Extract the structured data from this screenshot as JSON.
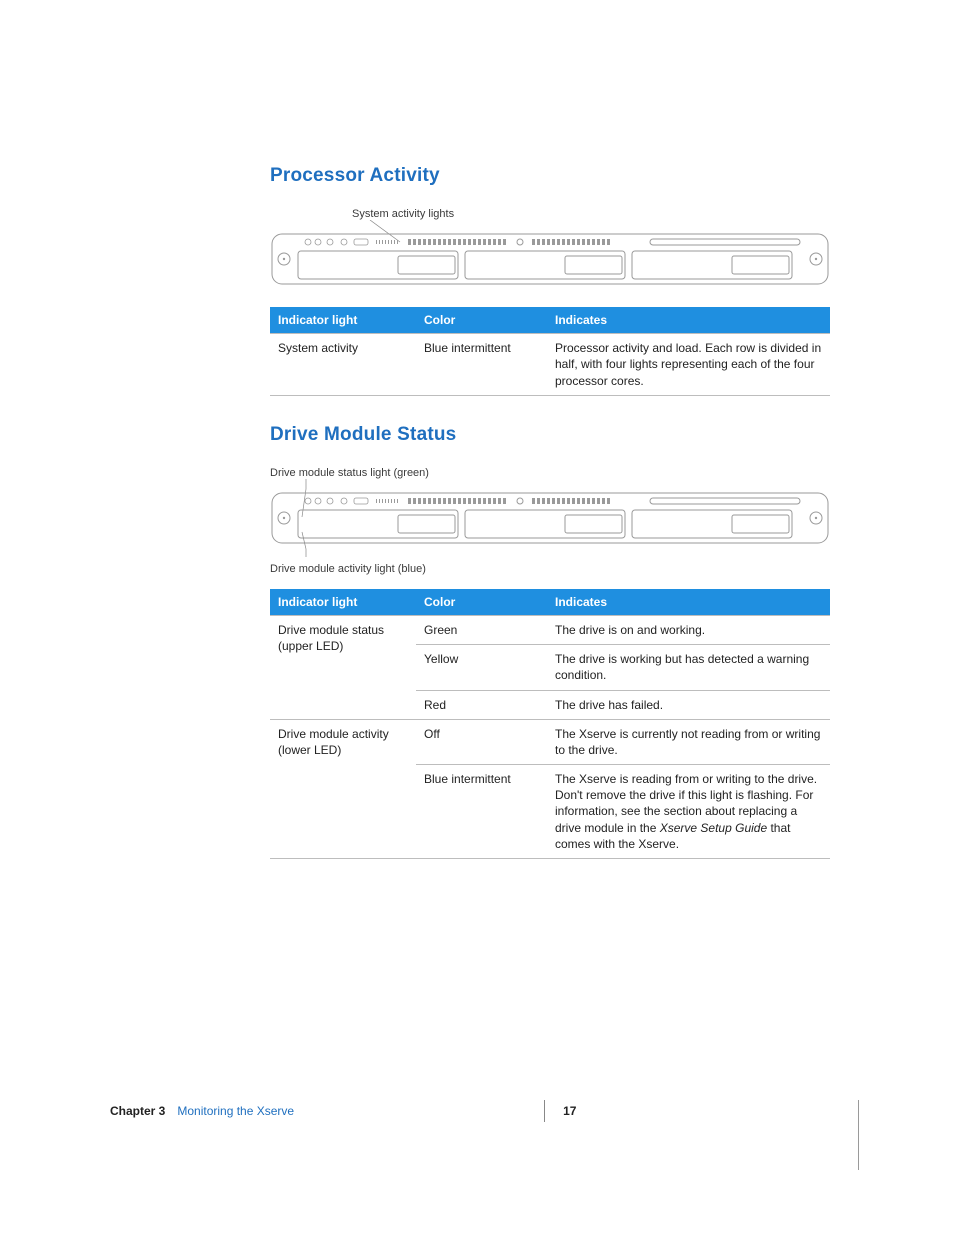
{
  "section1": {
    "heading": "Processor Activity",
    "callout": "System activity lights",
    "table": {
      "headers": [
        "Indicator light",
        "Color",
        "Indicates"
      ],
      "rows": [
        {
          "light": "System activity",
          "color": "Blue intermittent",
          "desc": "Processor activity and load. Each row is divided in half, with four lights representing each of the four processor cores."
        }
      ]
    }
  },
  "section2": {
    "heading": "Drive Module Status",
    "callout_upper": "Drive module status light (green)",
    "callout_lower": "Drive module activity light (blue)",
    "table": {
      "headers": [
        "Indicator light",
        "Color",
        "Indicates"
      ],
      "groups": [
        {
          "light": "Drive module status (upper LED)",
          "rows": [
            {
              "color": "Green",
              "desc": "The drive is on and working."
            },
            {
              "color": "Yellow",
              "desc": "The drive is working but has detected a warning condition."
            },
            {
              "color": "Red",
              "desc": "The drive has failed."
            }
          ]
        },
        {
          "light": "Drive module activity (lower LED)",
          "rows": [
            {
              "color": "Off",
              "desc": "The Xserve is currently not reading from or writing to the drive."
            },
            {
              "color": "Blue intermittent",
              "desc_pre": "The Xserve is reading from or writing to the drive. Don't remove the drive if this light is flashing. For information, see the section about replacing a drive module in the ",
              "desc_italic": "Xserve Setup Guide",
              "desc_post": " that comes with the Xserve."
            }
          ]
        }
      ]
    }
  },
  "footer": {
    "chapter_label": "Chapter 3",
    "chapter_title": "Monitoring the Xserve",
    "page_number": "17"
  }
}
